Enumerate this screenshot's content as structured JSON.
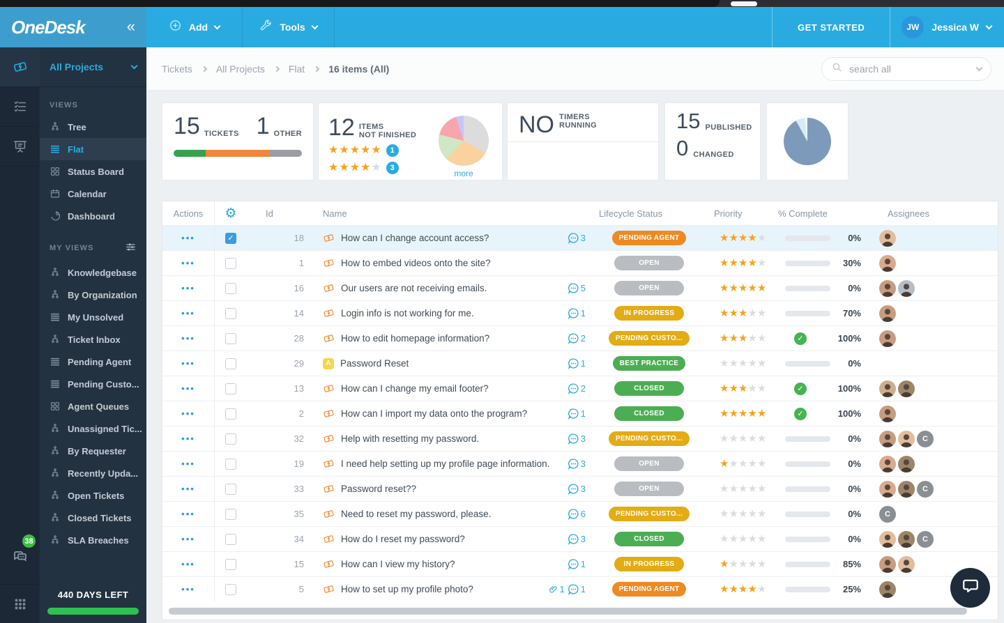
{
  "header": {
    "logo": "OneDesk",
    "collapse_icon": "«",
    "menus": [
      {
        "id": "add",
        "label": "Add",
        "icon": "plus-circle-icon"
      },
      {
        "id": "tools",
        "label": "Tools",
        "icon": "wrench-icon"
      }
    ],
    "get_started_label": "GET STARTED",
    "user": {
      "initials": "JW",
      "name": "Jessica W"
    },
    "colors": {
      "bar": "#29abe2",
      "logo_block": "#3d9ecd"
    }
  },
  "sidebar": {
    "rail": [
      {
        "icon": "ticket-icon",
        "active": true
      },
      {
        "icon": "tasks-icon",
        "active": false
      },
      {
        "icon": "board-icon",
        "active": false
      }
    ],
    "project_selector": {
      "label": "All Projects"
    },
    "sections": [
      {
        "label": "VIEWS",
        "filter_icon": false,
        "items": [
          {
            "icon": "tree",
            "label": "Tree",
            "active": false
          },
          {
            "icon": "flat",
            "label": "Flat",
            "active": true
          },
          {
            "icon": "grid",
            "label": "Status Board",
            "active": false
          },
          {
            "icon": "calendar",
            "label": "Calendar",
            "active": false
          },
          {
            "icon": "pie",
            "label": "Dashboard",
            "active": false
          }
        ]
      },
      {
        "label": "MY VIEWS",
        "filter_icon": true,
        "items": [
          {
            "icon": "tree",
            "label": "Knowledgebase"
          },
          {
            "icon": "tree",
            "label": "By Organization"
          },
          {
            "icon": "flat",
            "label": "My Unsolved"
          },
          {
            "icon": "tree",
            "label": "Ticket Inbox"
          },
          {
            "icon": "flat",
            "label": "Pending Agent"
          },
          {
            "icon": "flat",
            "label": "Pending Custo..."
          },
          {
            "icon": "grid",
            "label": "Agent Queues"
          },
          {
            "icon": "tree",
            "label": "Unassigned Tic..."
          },
          {
            "icon": "tree",
            "label": "By Requester"
          },
          {
            "icon": "tree",
            "label": "Recently Upda..."
          },
          {
            "icon": "tree",
            "label": "Open Tickets"
          },
          {
            "icon": "tree",
            "label": "Closed Tickets"
          },
          {
            "icon": "tree",
            "label": "SLA Breaches"
          }
        ]
      }
    ],
    "chat_badge": "38",
    "days_left": "440 DAYS LEFT",
    "colors": {
      "rail": "#1c2836",
      "panel": "#233240",
      "accent": "#29abe2",
      "days_bar": "#2ec151",
      "badge": "#3cc13f"
    }
  },
  "breadcrumb": {
    "items": [
      "Tickets",
      "All Projects",
      "Flat"
    ],
    "current": "16 items (All)"
  },
  "search": {
    "placeholder": "search all"
  },
  "cards": {
    "tickets": {
      "count": "15",
      "count_label": "TICKETS",
      "other": "1",
      "other_label": "OTHER",
      "bar": [
        {
          "color": "#36a24e",
          "pct": 25
        },
        {
          "color": "#f0873c",
          "pct": 50
        },
        {
          "color": "#9b9fa3",
          "pct": 25
        }
      ]
    },
    "not_finished": {
      "count": "12",
      "label_line1": "ITEMS",
      "label_line2": "NOT FINISHED",
      "ratings": [
        {
          "stars": 5,
          "count": "1"
        },
        {
          "stars": 4,
          "count": "3"
        }
      ],
      "pie": [
        {
          "color": "#dcdcdc",
          "pct": 33
        },
        {
          "color": "#fbd1a0",
          "pct": 29
        },
        {
          "color": "#cfe7c5",
          "pct": 17
        },
        {
          "color": "#f8a5ad",
          "pct": 16
        },
        {
          "color": "#c6c5f8",
          "pct": 5
        }
      ],
      "more_label": "more"
    },
    "timers": {
      "count": "NO",
      "label_line1": "TIMERS",
      "label_line2": "RUNNING"
    },
    "published": {
      "count": "15",
      "count_label": "PUBLISHED",
      "changed": "0",
      "changed_label": "CHANGED"
    },
    "pie_card": {
      "pie": [
        {
          "color": "#7e9aba",
          "pct": 92
        },
        {
          "color": "#d4ecf3",
          "pct": 6
        },
        {
          "color": "#eef6f8",
          "pct": 2
        }
      ]
    }
  },
  "table": {
    "headers": {
      "actions": "Actions",
      "id": "Id",
      "name": "Name",
      "status": "Lifecycle Status",
      "priority": "Priority",
      "complete": "% Complete",
      "assignees": "Assignees"
    },
    "actions_glyph": "•••",
    "avatar_colors": [
      "#e2bd9d",
      "#d8ab8d",
      "#c79c7f",
      "#b4bec6",
      "#cdae8c",
      "#9c8568"
    ],
    "avatar_fallback": {
      "label": "C",
      "color": "#8a8f94"
    },
    "rows": [
      {
        "id": "18",
        "name": "How can I change account access?",
        "comments": "3",
        "status": {
          "label": "PENDING AGENT",
          "color": "#ef8921"
        },
        "priority": 4,
        "complete": {
          "pct": "0%",
          "value": 0
        },
        "assignees": [
          0
        ],
        "selected": true,
        "checked": true
      },
      {
        "id": "1",
        "name": "How to embed videos onto the site?",
        "status": {
          "label": "OPEN",
          "color": "#b9bdc1"
        },
        "priority": 4,
        "complete": {
          "pct": "30%",
          "value": 30
        },
        "assignees": [
          1
        ]
      },
      {
        "id": "16",
        "name": "Our users are not receiving emails.",
        "comments": "5",
        "status": {
          "label": "OPEN",
          "color": "#b9bdc1"
        },
        "priority": 5,
        "complete": {
          "pct": "0%",
          "value": 0
        },
        "assignees": [
          2,
          3
        ]
      },
      {
        "id": "14",
        "name": "Login info is not working for me.",
        "comments": "1",
        "status": {
          "label": "IN PROGRESS",
          "color": "#e3ab15"
        },
        "priority": 3,
        "complete": {
          "pct": "70%",
          "value": 70
        },
        "assignees": [
          2
        ]
      },
      {
        "id": "28",
        "name": "How to edit homepage information?",
        "comments": "2",
        "status": {
          "label": "PENDING CUSTO...",
          "color": "#e3ab15"
        },
        "priority": 3,
        "complete": {
          "pct": "100%",
          "value": 100,
          "done": true
        },
        "assignees": [
          2
        ]
      },
      {
        "id": "29",
        "name": "Password Reset",
        "type": "article",
        "comments": "1",
        "status": {
          "label": "BEST PRACTICE",
          "color": "#4cae53"
        },
        "priority": 0,
        "complete": {
          "pct": "0%",
          "value": 0
        },
        "assignees": []
      },
      {
        "id": "13",
        "name": "How can I change my email footer?",
        "comments": "2",
        "status": {
          "label": "CLOSED",
          "color": "#4cae53"
        },
        "priority": 3,
        "complete": {
          "pct": "100%",
          "value": 100,
          "done": true
        },
        "assignees": [
          4,
          5
        ]
      },
      {
        "id": "2",
        "name": "How can I import my data onto the program?",
        "comments": "1",
        "status": {
          "label": "CLOSED",
          "color": "#4cae53"
        },
        "priority": 5,
        "complete": {
          "pct": "100%",
          "value": 100,
          "done": true
        },
        "assignees": [
          2
        ]
      },
      {
        "id": "32",
        "name": "Help with resetting my password.",
        "comments": "3",
        "status": {
          "label": "PENDING CUSTO...",
          "color": "#e3ab15"
        },
        "priority": 0,
        "complete": {
          "pct": "0%",
          "value": 0
        },
        "assignees": [
          2,
          0,
          "C"
        ]
      },
      {
        "id": "19",
        "name": "I need help setting up my profile page information.",
        "comments": "3",
        "status": {
          "label": "OPEN",
          "color": "#b9bdc1"
        },
        "priority": 1,
        "complete": {
          "pct": "0%",
          "value": 0
        },
        "assignees": [
          1,
          5
        ]
      },
      {
        "id": "33",
        "name": "Password reset??",
        "comments": "3",
        "status": {
          "label": "OPEN",
          "color": "#b9bdc1"
        },
        "priority": 0,
        "complete": {
          "pct": "0%",
          "value": 0
        },
        "assignees": [
          1,
          5,
          "C"
        ]
      },
      {
        "id": "35",
        "name": "Need to reset my password, please.",
        "comments": "6",
        "status": {
          "label": "PENDING CUSTO...",
          "color": "#e3ab15"
        },
        "priority": 0,
        "complete": {
          "pct": "0%",
          "value": 0
        },
        "assignees": [
          "C"
        ]
      },
      {
        "id": "34",
        "name": "How do I reset my password?",
        "comments": "3",
        "status": {
          "label": "CLOSED",
          "color": "#4cae53"
        },
        "priority": 0,
        "complete": {
          "pct": "0%",
          "value": 0
        },
        "assignees": [
          0,
          5,
          "C"
        ]
      },
      {
        "id": "15",
        "name": "How can I view my history?",
        "comments": "1",
        "status": {
          "label": "IN PROGRESS",
          "color": "#e3ab15"
        },
        "priority": 1,
        "complete": {
          "pct": "85%",
          "value": 85
        },
        "assignees": [
          2,
          0
        ]
      },
      {
        "id": "5",
        "name": "How to set up my profile photo?",
        "attachments": "1",
        "comments": "1",
        "status": {
          "label": "PENDING AGENT",
          "color": "#ef8921"
        },
        "priority": 4,
        "complete": {
          "pct": "25%",
          "value": 25
        },
        "assignees": [
          5
        ]
      }
    ]
  },
  "status_colors": {
    "orange": "#ef8921",
    "amber": "#e3ab15",
    "gray": "#b9bdc1",
    "green": "#4cae53"
  }
}
